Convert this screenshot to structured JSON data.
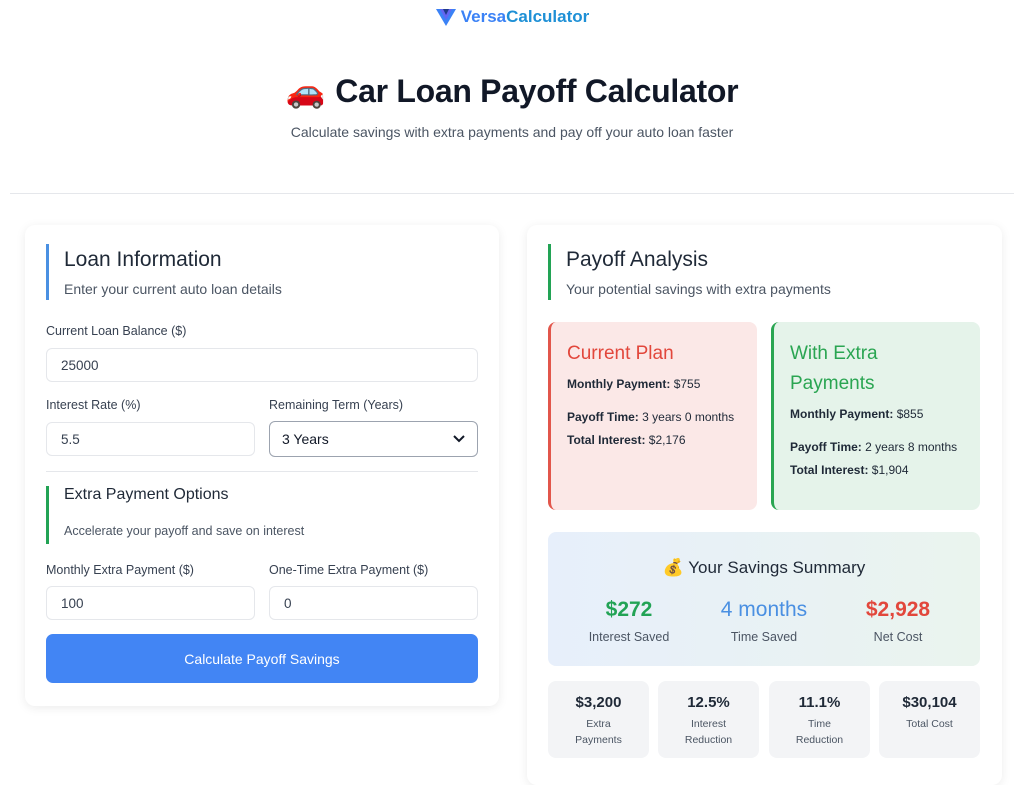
{
  "brand": {
    "part1": "Versa",
    "part2": "Calculator"
  },
  "hero": {
    "emoji": "🚗",
    "title": "Car Loan Payoff Calculator",
    "subtitle": "Calculate savings with extra payments and pay off your auto loan faster"
  },
  "loan": {
    "title": "Loan Information",
    "subtitle": "Enter your current auto loan details",
    "balance_label": "Current Loan Balance ($)",
    "balance_value": "25000",
    "rate_label": "Interest Rate (%)",
    "rate_value": "5.5",
    "term_label": "Remaining Term (Years)",
    "term_value": "3 Years"
  },
  "extra": {
    "title": "Extra Payment Options",
    "subtitle": "Accelerate your payoff and save on interest",
    "monthly_label": "Monthly Extra Payment ($)",
    "monthly_value": "100",
    "onetime_label": "One-Time Extra Payment ($)",
    "onetime_value": "0"
  },
  "calculate_button": "Calculate Payoff Savings",
  "analysis": {
    "title": "Payoff Analysis",
    "subtitle": "Your potential savings with extra payments"
  },
  "current_plan": {
    "title": "Current Plan",
    "monthly_label": "Monthly Payment:",
    "monthly_value": "$755",
    "payoff_label": "Payoff Time:",
    "payoff_value": "3 years 0 months",
    "interest_label": "Total Interest:",
    "interest_value": "$2,176"
  },
  "extra_plan": {
    "title": "With Extra Payments",
    "monthly_label": "Monthly Payment:",
    "monthly_value": "$855",
    "payoff_label": "Payoff Time:",
    "payoff_value": "2 years 8 months",
    "interest_label": "Total Interest:",
    "interest_value": "$1,904"
  },
  "summary": {
    "emoji": "💰",
    "title": "Your Savings Summary",
    "stats": [
      {
        "value": "$272",
        "label": "Interest Saved",
        "color": "#22a355"
      },
      {
        "value": "4 months",
        "label": "Time Saved",
        "color": "#4a90e2"
      },
      {
        "value": "$2,928",
        "label": "Net Cost",
        "color": "#e2473c"
      }
    ]
  },
  "tiles": [
    {
      "value": "$3,200",
      "label1": "Extra",
      "label2": "Payments"
    },
    {
      "value": "12.5%",
      "label1": "Interest",
      "label2": "Reduction"
    },
    {
      "value": "11.1%",
      "label1": "Time",
      "label2": "Reduction"
    },
    {
      "value": "$30,104",
      "label1": "Total Cost",
      "label2": ""
    }
  ]
}
